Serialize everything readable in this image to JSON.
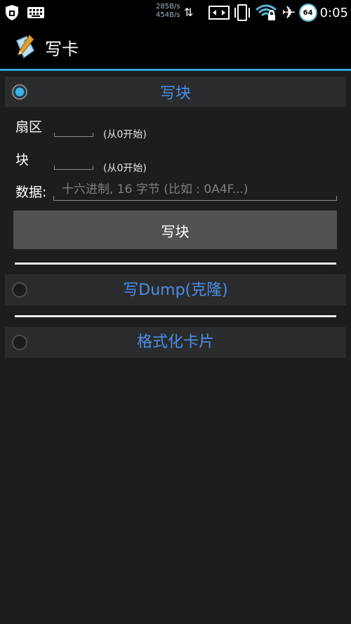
{
  "status_bar": {
    "net_up": "285B/s",
    "net_down": "454B/s",
    "battery_level": "64",
    "time": "0:05",
    "icons": [
      "shield-icon",
      "keyboard-icon",
      "transfer-arrows-icon",
      "screen-mirror-icon",
      "phone-vibrate-icon",
      "wifi-lock-icon",
      "airplane-icon"
    ]
  },
  "action_bar": {
    "title": "写卡",
    "icon": "tag-pencil-icon"
  },
  "accent_color": "#2fa7d8",
  "title_color": "#4a8fe8",
  "sections": [
    {
      "title": "写块",
      "checked": true,
      "fields": {
        "sector_label": "扇区",
        "sector_hint": "(从0开始)",
        "block_label": "块",
        "block_hint": "(从0开始)",
        "data_label": "数据:",
        "data_placeholder": "十六进制, 16 字节 (比如 : 0A4F...)"
      },
      "button_label": "写块"
    },
    {
      "title": "写Dump(克隆)",
      "checked": false
    },
    {
      "title": "格式化卡片",
      "checked": false
    }
  ]
}
